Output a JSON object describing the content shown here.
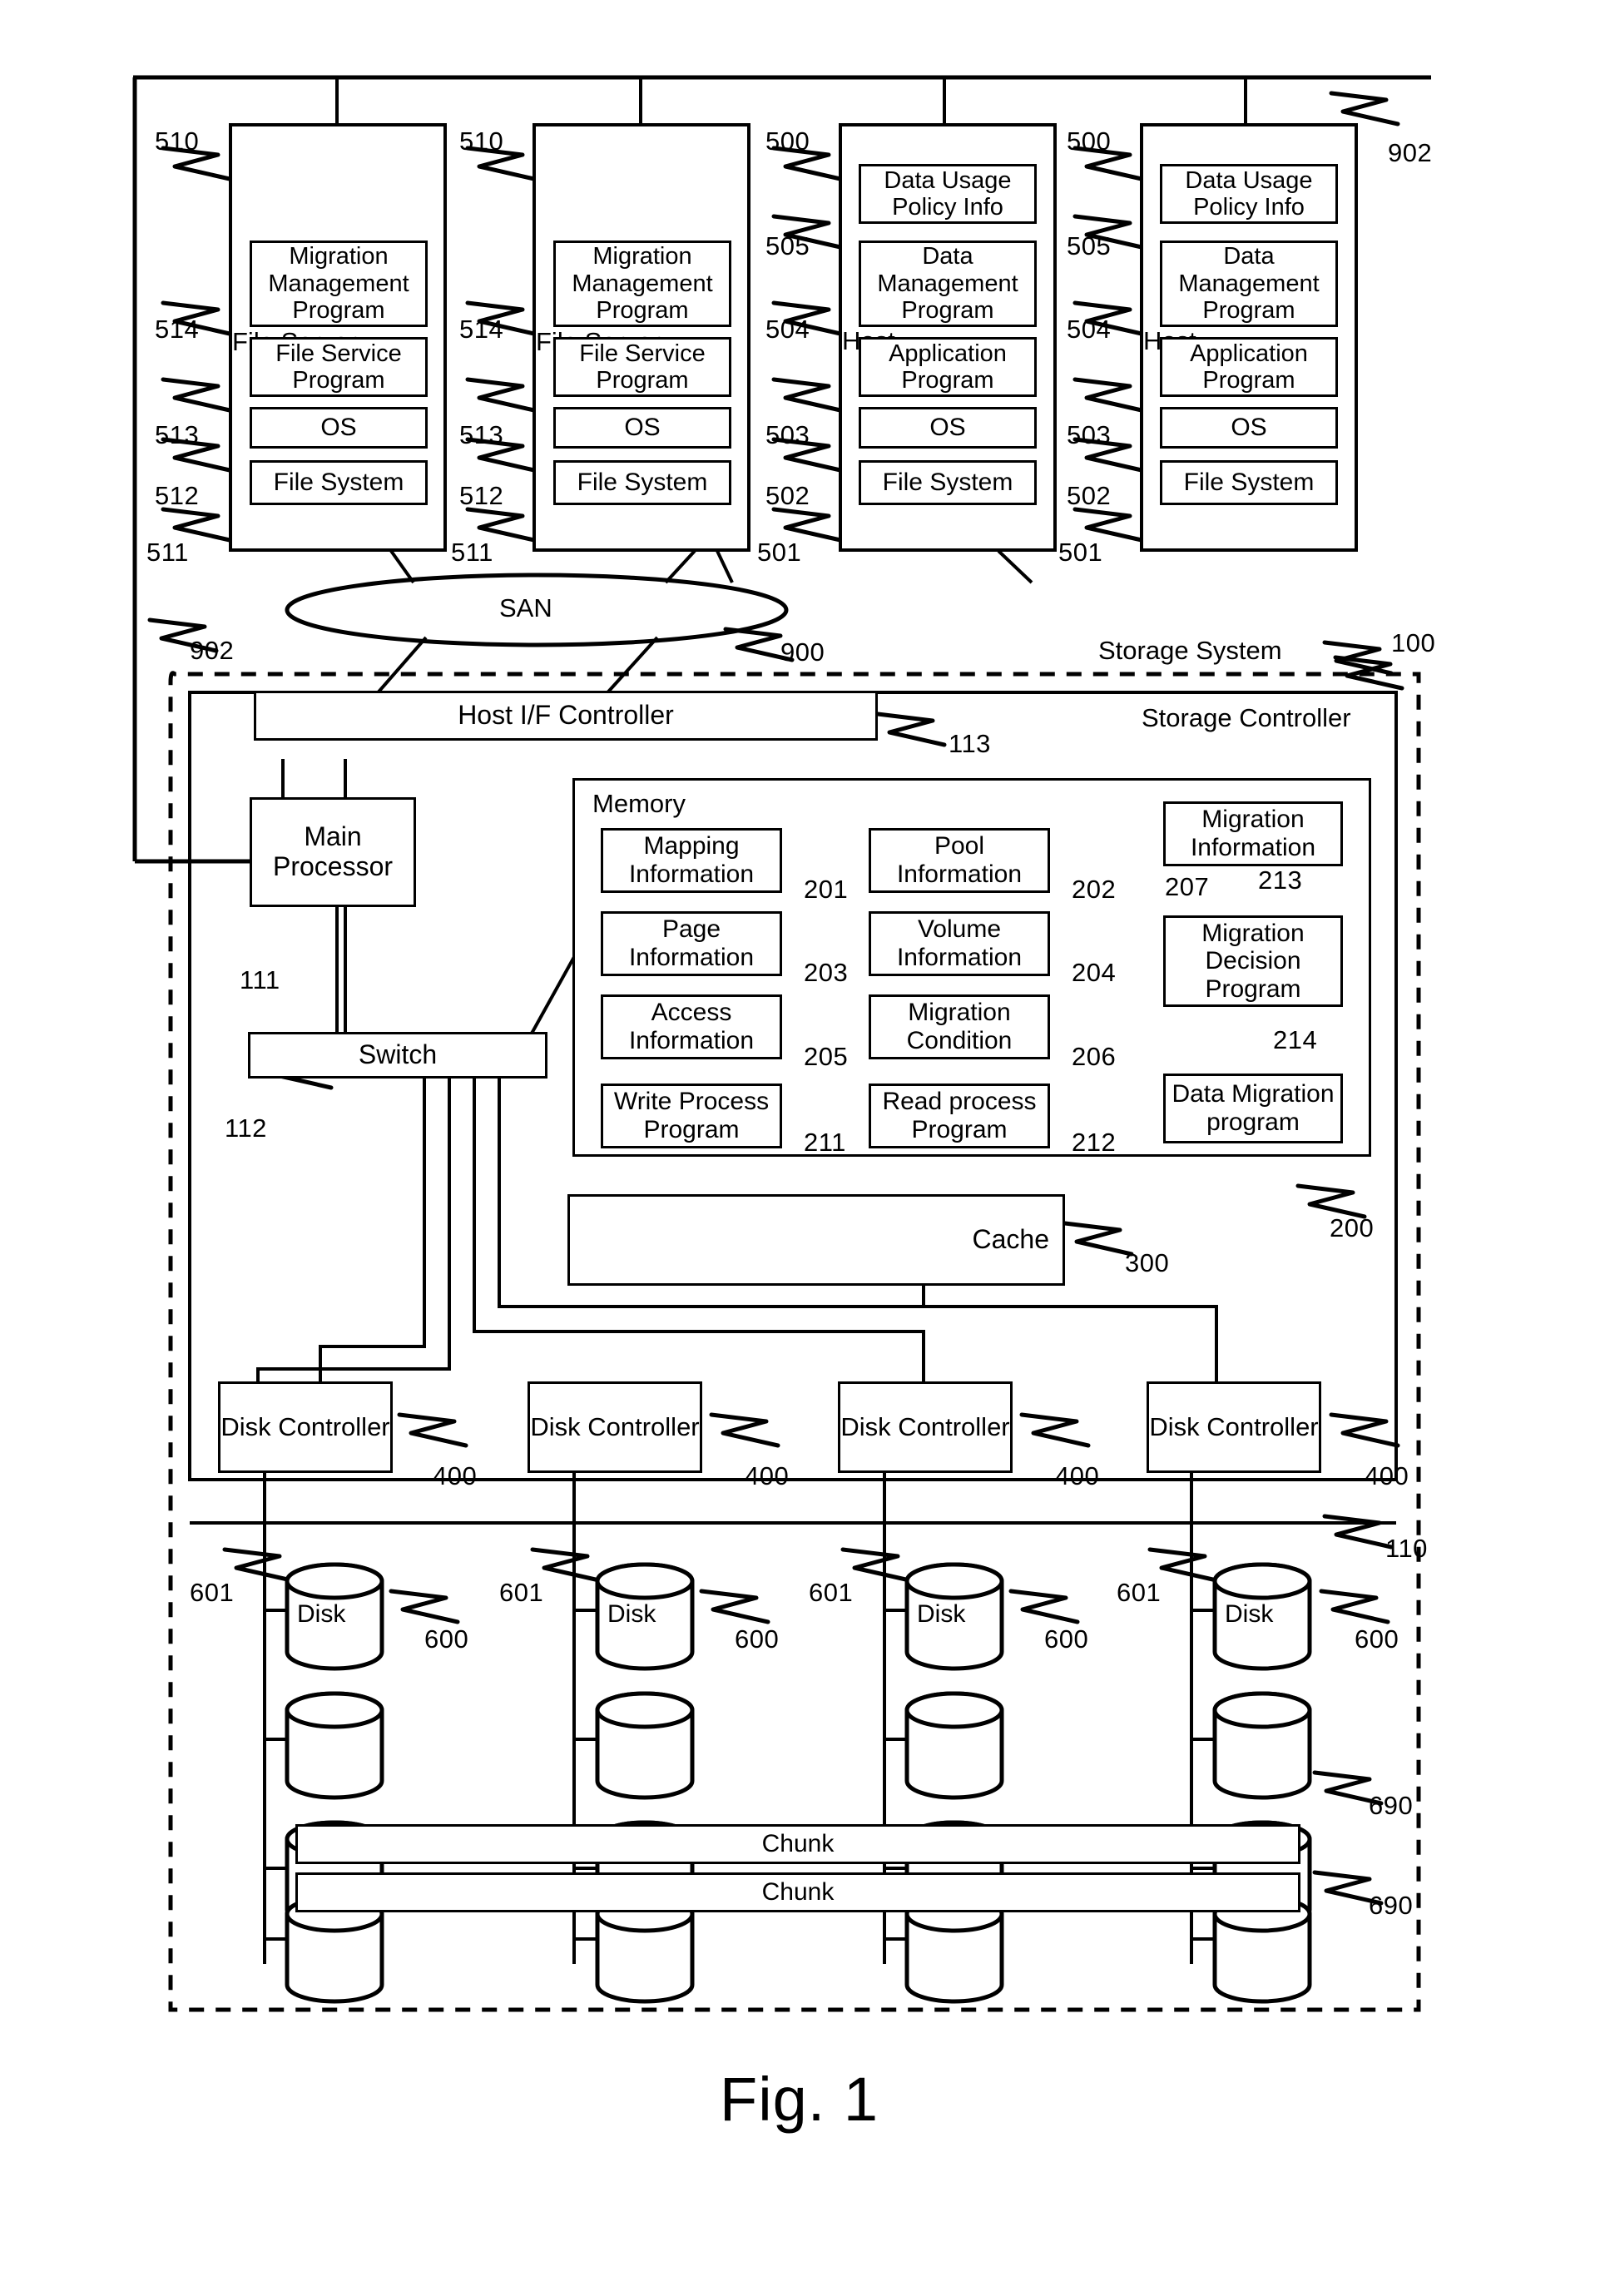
{
  "figure": {
    "caption": "Fig. 1"
  },
  "network": {
    "lan_ref": "902",
    "san_label": "SAN",
    "san_ref": "900"
  },
  "file_servers": [
    {
      "title": "File Server",
      "ref": "510",
      "components": [
        {
          "label": "Migration Management Program",
          "ref": "514"
        },
        {
          "label": "File Service Program",
          "ref": "513"
        },
        {
          "label": "OS",
          "ref": "512"
        },
        {
          "label": "File System",
          "ref": "511"
        }
      ]
    },
    {
      "title": "File Server",
      "ref": "510",
      "components": [
        {
          "label": "Migration Management Program",
          "ref": "514"
        },
        {
          "label": "File Service Program",
          "ref": "513"
        },
        {
          "label": "OS",
          "ref": "512"
        },
        {
          "label": "File System",
          "ref": "511"
        }
      ]
    }
  ],
  "hosts": [
    {
      "title": "Host",
      "ref": "500",
      "components": [
        {
          "label": "Data Usage Policy Info",
          "ref": "505"
        },
        {
          "label": "Data Management Program",
          "ref": "504"
        },
        {
          "label": "Application Program",
          "ref": "503"
        },
        {
          "label": "OS",
          "ref": "502"
        },
        {
          "label": "File System",
          "ref": "501"
        }
      ]
    },
    {
      "title": "Host",
      "ref": "500",
      "components": [
        {
          "label": "Data Usage Policy Info",
          "ref": "505"
        },
        {
          "label": "Data Management Program",
          "ref": "504"
        },
        {
          "label": "Application Program",
          "ref": "503"
        },
        {
          "label": "OS",
          "ref": "502"
        },
        {
          "label": "File System",
          "ref": "501"
        }
      ]
    }
  ],
  "storage_system": {
    "label": "Storage System",
    "ref": "100",
    "controller_label": "Storage Controller",
    "host_if_controller": {
      "label": "Host I/F Controller",
      "ref": "113"
    },
    "main_processor": {
      "label": "Main Processor",
      "ref": "111"
    },
    "switch": {
      "label": "Switch",
      "ref": "112"
    },
    "cache": {
      "label": "Cache",
      "ref": "300"
    },
    "memory": {
      "label": "Memory",
      "ref": "200",
      "items": [
        {
          "label": "Mapping Information",
          "ref": "201"
        },
        {
          "label": "Pool Information",
          "ref": "202"
        },
        {
          "label": "Migration Information",
          "ref": "207"
        },
        {
          "label": "Page Information",
          "ref": "203"
        },
        {
          "label": "Volume Information",
          "ref": "204"
        },
        {
          "label": "Migration Decision Program",
          "ref": "213"
        },
        {
          "label": "Access Information",
          "ref": "205"
        },
        {
          "label": "Migration Condition",
          "ref": "206"
        },
        {
          "label": "Data Migration program",
          "ref": "214"
        },
        {
          "label": "Write Process Program",
          "ref": "211"
        },
        {
          "label": "Read process Program",
          "ref": "212"
        }
      ]
    },
    "disk_controllers": [
      {
        "label": "Disk Controller",
        "ref": "400"
      },
      {
        "label": "Disk Controller",
        "ref": "400"
      },
      {
        "label": "Disk Controller",
        "ref": "400"
      },
      {
        "label": "Disk Controller",
        "ref": "400"
      }
    ],
    "disk_unit": {
      "ref": "110"
    },
    "disks": [
      {
        "label": "Disk",
        "disk_ref": "600",
        "conn_ref": "601"
      },
      {
        "label": "Disk",
        "disk_ref": "600",
        "conn_ref": "601"
      },
      {
        "label": "Disk",
        "disk_ref": "600",
        "conn_ref": "601"
      },
      {
        "label": "Disk",
        "disk_ref": "600",
        "conn_ref": "601"
      }
    ],
    "chunks": [
      {
        "label": "Chunk",
        "ref": "690"
      },
      {
        "label": "Chunk",
        "ref": "690"
      }
    ]
  }
}
